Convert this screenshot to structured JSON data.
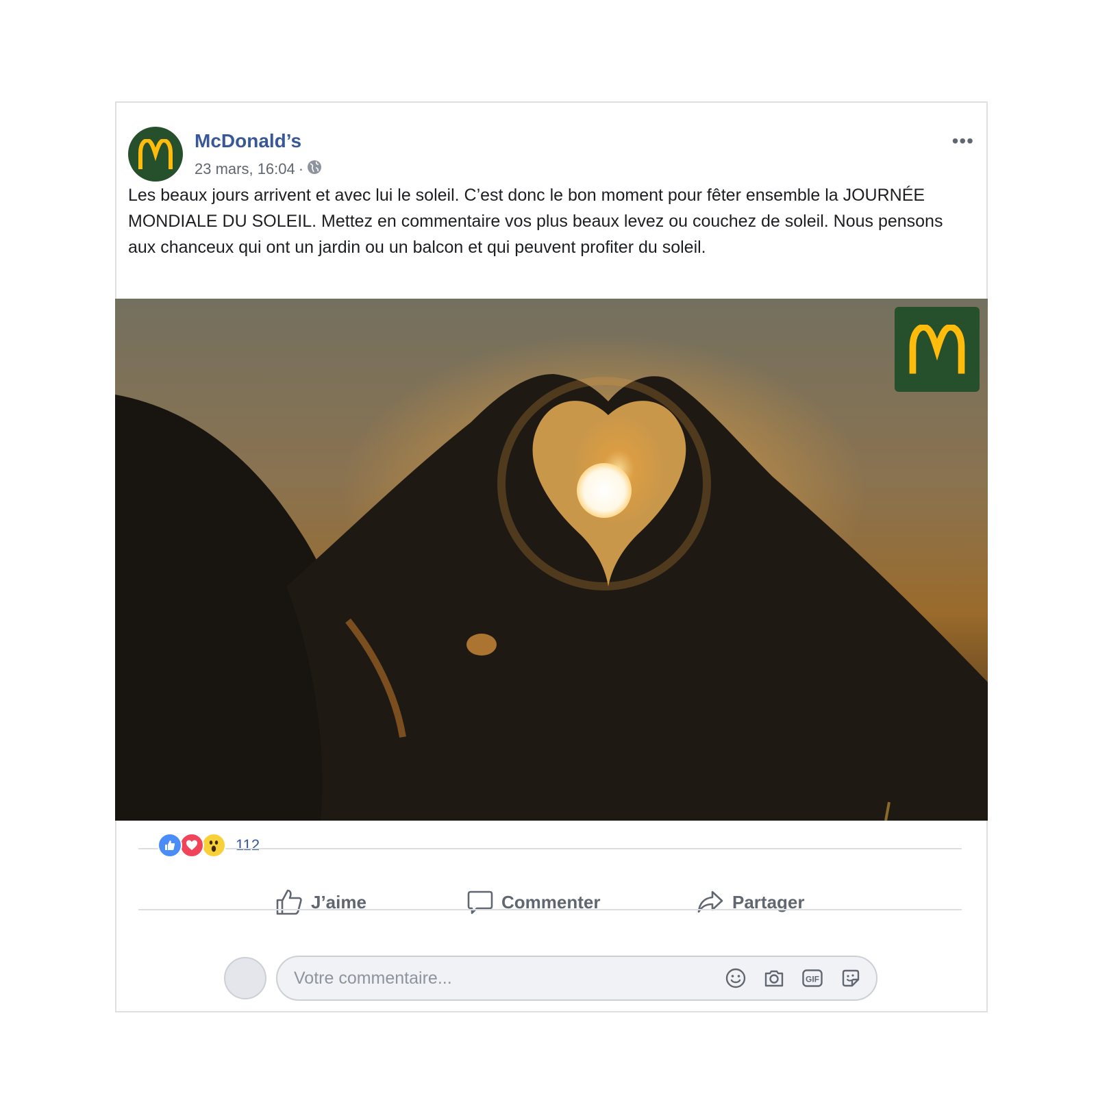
{
  "post": {
    "page_name": "McDonald’s",
    "timestamp": "23 mars, 16:04",
    "separator": "·",
    "privacy_icon": "globe-icon",
    "more_label": "•••",
    "caption": "Les beaux jours arrivent et avec lui le soleil. C’est donc le bon moment pour fêter ensemble la JOURNÉE MONDIALE DU SOLEIL. Mettez en commentaire vos plus beaux levez ou couchez de soleil. Nous pensons aux chanceux qui ont un jardin ou un balcon et qui peuvent profiter du soleil.",
    "brand_colors": {
      "green": "#264f2b",
      "gold": "#ffbc0d"
    }
  },
  "reactions": {
    "types": [
      "like-icon",
      "love-icon",
      "wow-icon"
    ],
    "count": "112"
  },
  "actions": {
    "like_label": "J’aime",
    "comment_label": "Commenter",
    "share_label": "Partager"
  },
  "comment_box": {
    "placeholder": "Votre commentaire...",
    "icons": [
      "emoji-icon",
      "camera-icon",
      "gif-icon",
      "sticker-icon"
    ],
    "gif_text": "GIF"
  }
}
